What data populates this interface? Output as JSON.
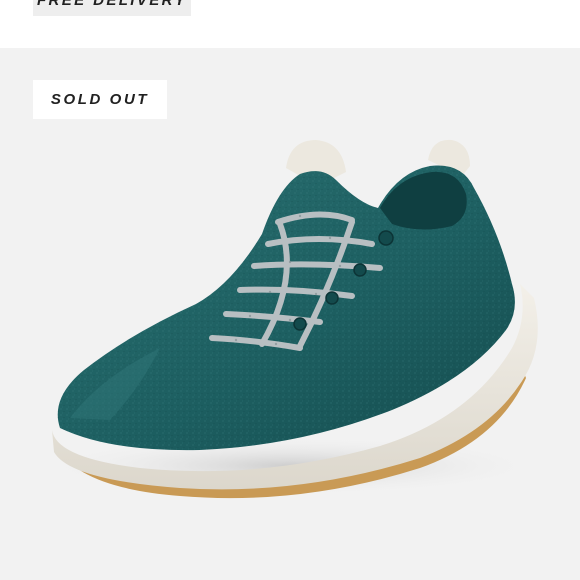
{
  "top_card": {
    "badge_label": "FREE DELIVERY"
  },
  "product_card": {
    "badge_label": "SOLD OUT",
    "image_alt": "Wool runner sneaker",
    "colors": {
      "background": "#f2f2f2",
      "upper": "#1c5f60",
      "sole": "#ece8df",
      "outsole": "#c99a55",
      "laces": "#b8bfc2"
    }
  }
}
